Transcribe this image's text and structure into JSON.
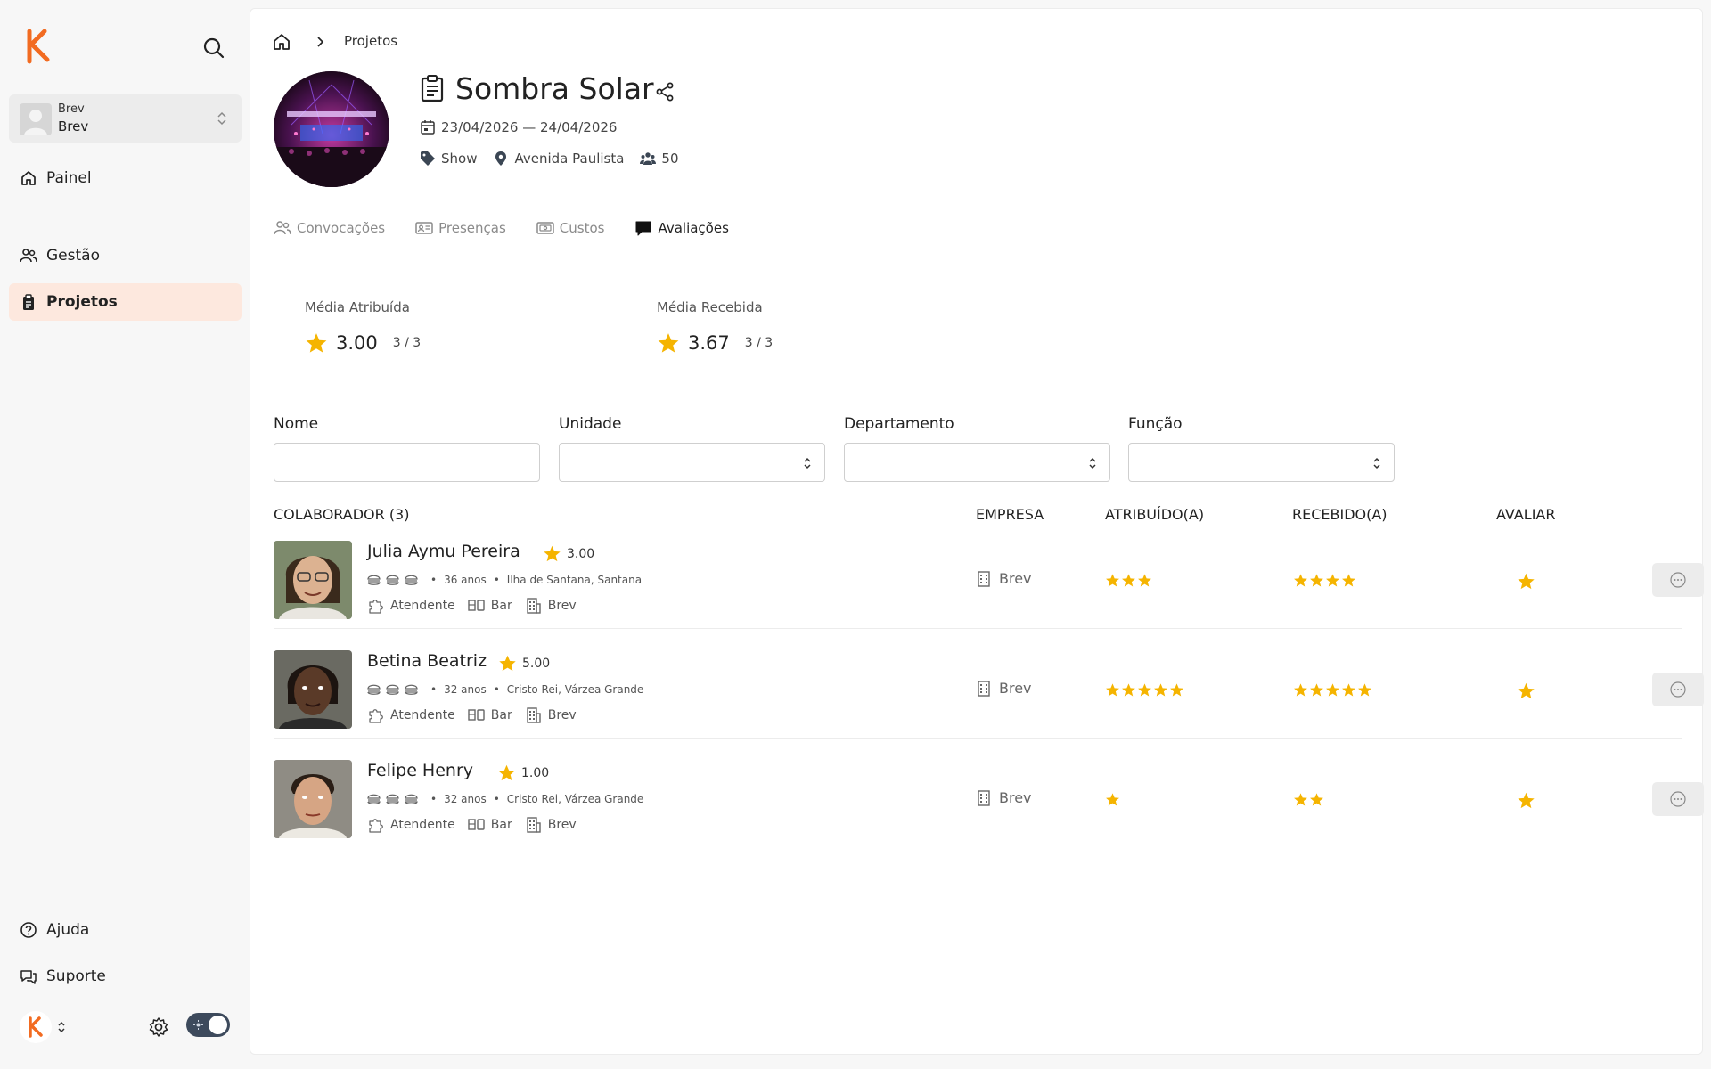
{
  "sidebar": {
    "org": {
      "line1": "Brev",
      "line2": "Brev"
    },
    "nav": [
      {
        "label": "Painel",
        "icon": "home-icon"
      },
      {
        "label": "Gestão",
        "icon": "users-icon"
      },
      {
        "label": "Projetos",
        "icon": "clipboard-icon",
        "active": true
      }
    ],
    "bottom": [
      {
        "label": "Ajuda",
        "icon": "help-icon"
      },
      {
        "label": "Suporte",
        "icon": "chat-icon"
      }
    ],
    "brand_color": "#f26b21"
  },
  "breadcrumb": {
    "current": "Projetos"
  },
  "project": {
    "title": "Sombra Solar",
    "dates": "23/04/2026 — 24/04/2026",
    "type": "Show",
    "location": "Avenida Paulista",
    "people": "50"
  },
  "tabs": [
    {
      "label": "Convocações",
      "icon": "users-icon"
    },
    {
      "label": "Presenças",
      "icon": "id-card-icon"
    },
    {
      "label": "Custos",
      "icon": "money-icon"
    },
    {
      "label": "Avaliações",
      "icon": "chat-bubble-icon",
      "active": true
    }
  ],
  "metrics": {
    "given": {
      "label": "Média Atribuída",
      "value": "3.00",
      "fraction": "3 / 3"
    },
    "received": {
      "label": "Média Recebida",
      "value": "3.67",
      "fraction": "3 / 3"
    }
  },
  "filters": {
    "name": "Nome",
    "unit": "Unidade",
    "department": "Departamento",
    "role": "Função"
  },
  "table": {
    "headers": {
      "collaborator": "COLABORADOR (3)",
      "company": "EMPRESA",
      "given": "ATRIBUÍDO(A)",
      "received": "RECEBIDO(A)",
      "rate": "AVALIAR"
    },
    "rows": [
      {
        "name": "Julia Aymu Pereira",
        "rating": "3.00",
        "age": "36 anos",
        "place": "Ilha de Santana, Santana",
        "role": "Atendente",
        "sector": "Bar",
        "org": "Brev",
        "company": "Brev",
        "given_stars": 3,
        "received_stars": 4
      },
      {
        "name": "Betina Beatriz",
        "rating": "5.00",
        "age": "32 anos",
        "place": "Cristo Rei, Várzea Grande",
        "role": "Atendente",
        "sector": "Bar",
        "org": "Brev",
        "company": "Brev",
        "given_stars": 5,
        "received_stars": 5
      },
      {
        "name": "Felipe Henry",
        "rating": "1.00",
        "age": "32 anos",
        "place": "Cristo Rei, Várzea Grande",
        "role": "Atendente",
        "sector": "Bar",
        "org": "Brev",
        "company": "Brev",
        "given_stars": 1,
        "received_stars": 2
      }
    ]
  },
  "colors": {
    "star": "#f5b400",
    "active_nav_bg": "#fde8de"
  }
}
